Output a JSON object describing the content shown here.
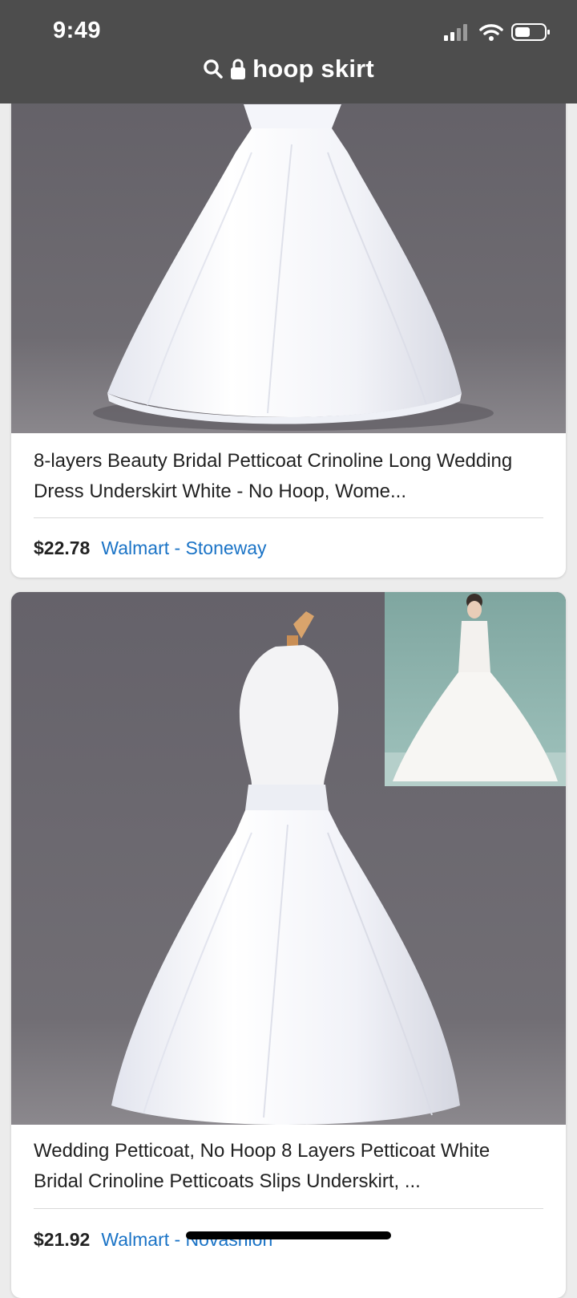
{
  "status_bar": {
    "time": "9:49",
    "icons": [
      "signal-icon",
      "wifi-icon",
      "battery-icon"
    ]
  },
  "url_bar": {
    "icons": [
      "search-icon",
      "lock-icon"
    ],
    "text": "hoop skirt"
  },
  "results": [
    {
      "title": "8-layers Beauty Bridal Petticoat Crinoline Long Wedding Dress Underskirt White - No Hoop, Wome...",
      "price": "$22.78",
      "seller": "Walmart - Stoneway"
    },
    {
      "title": "Wedding Petticoat, No Hoop 8 Layers Petticoat White Bridal Crinoline Petticoats Slips Underskirt, ...",
      "price": "$21.92",
      "seller": "Walmart - Novashion"
    }
  ],
  "colors": {
    "top_bar": "#4d4d4d",
    "seller_link": "#1a73c6",
    "photo_bg": "#6d6b70"
  }
}
